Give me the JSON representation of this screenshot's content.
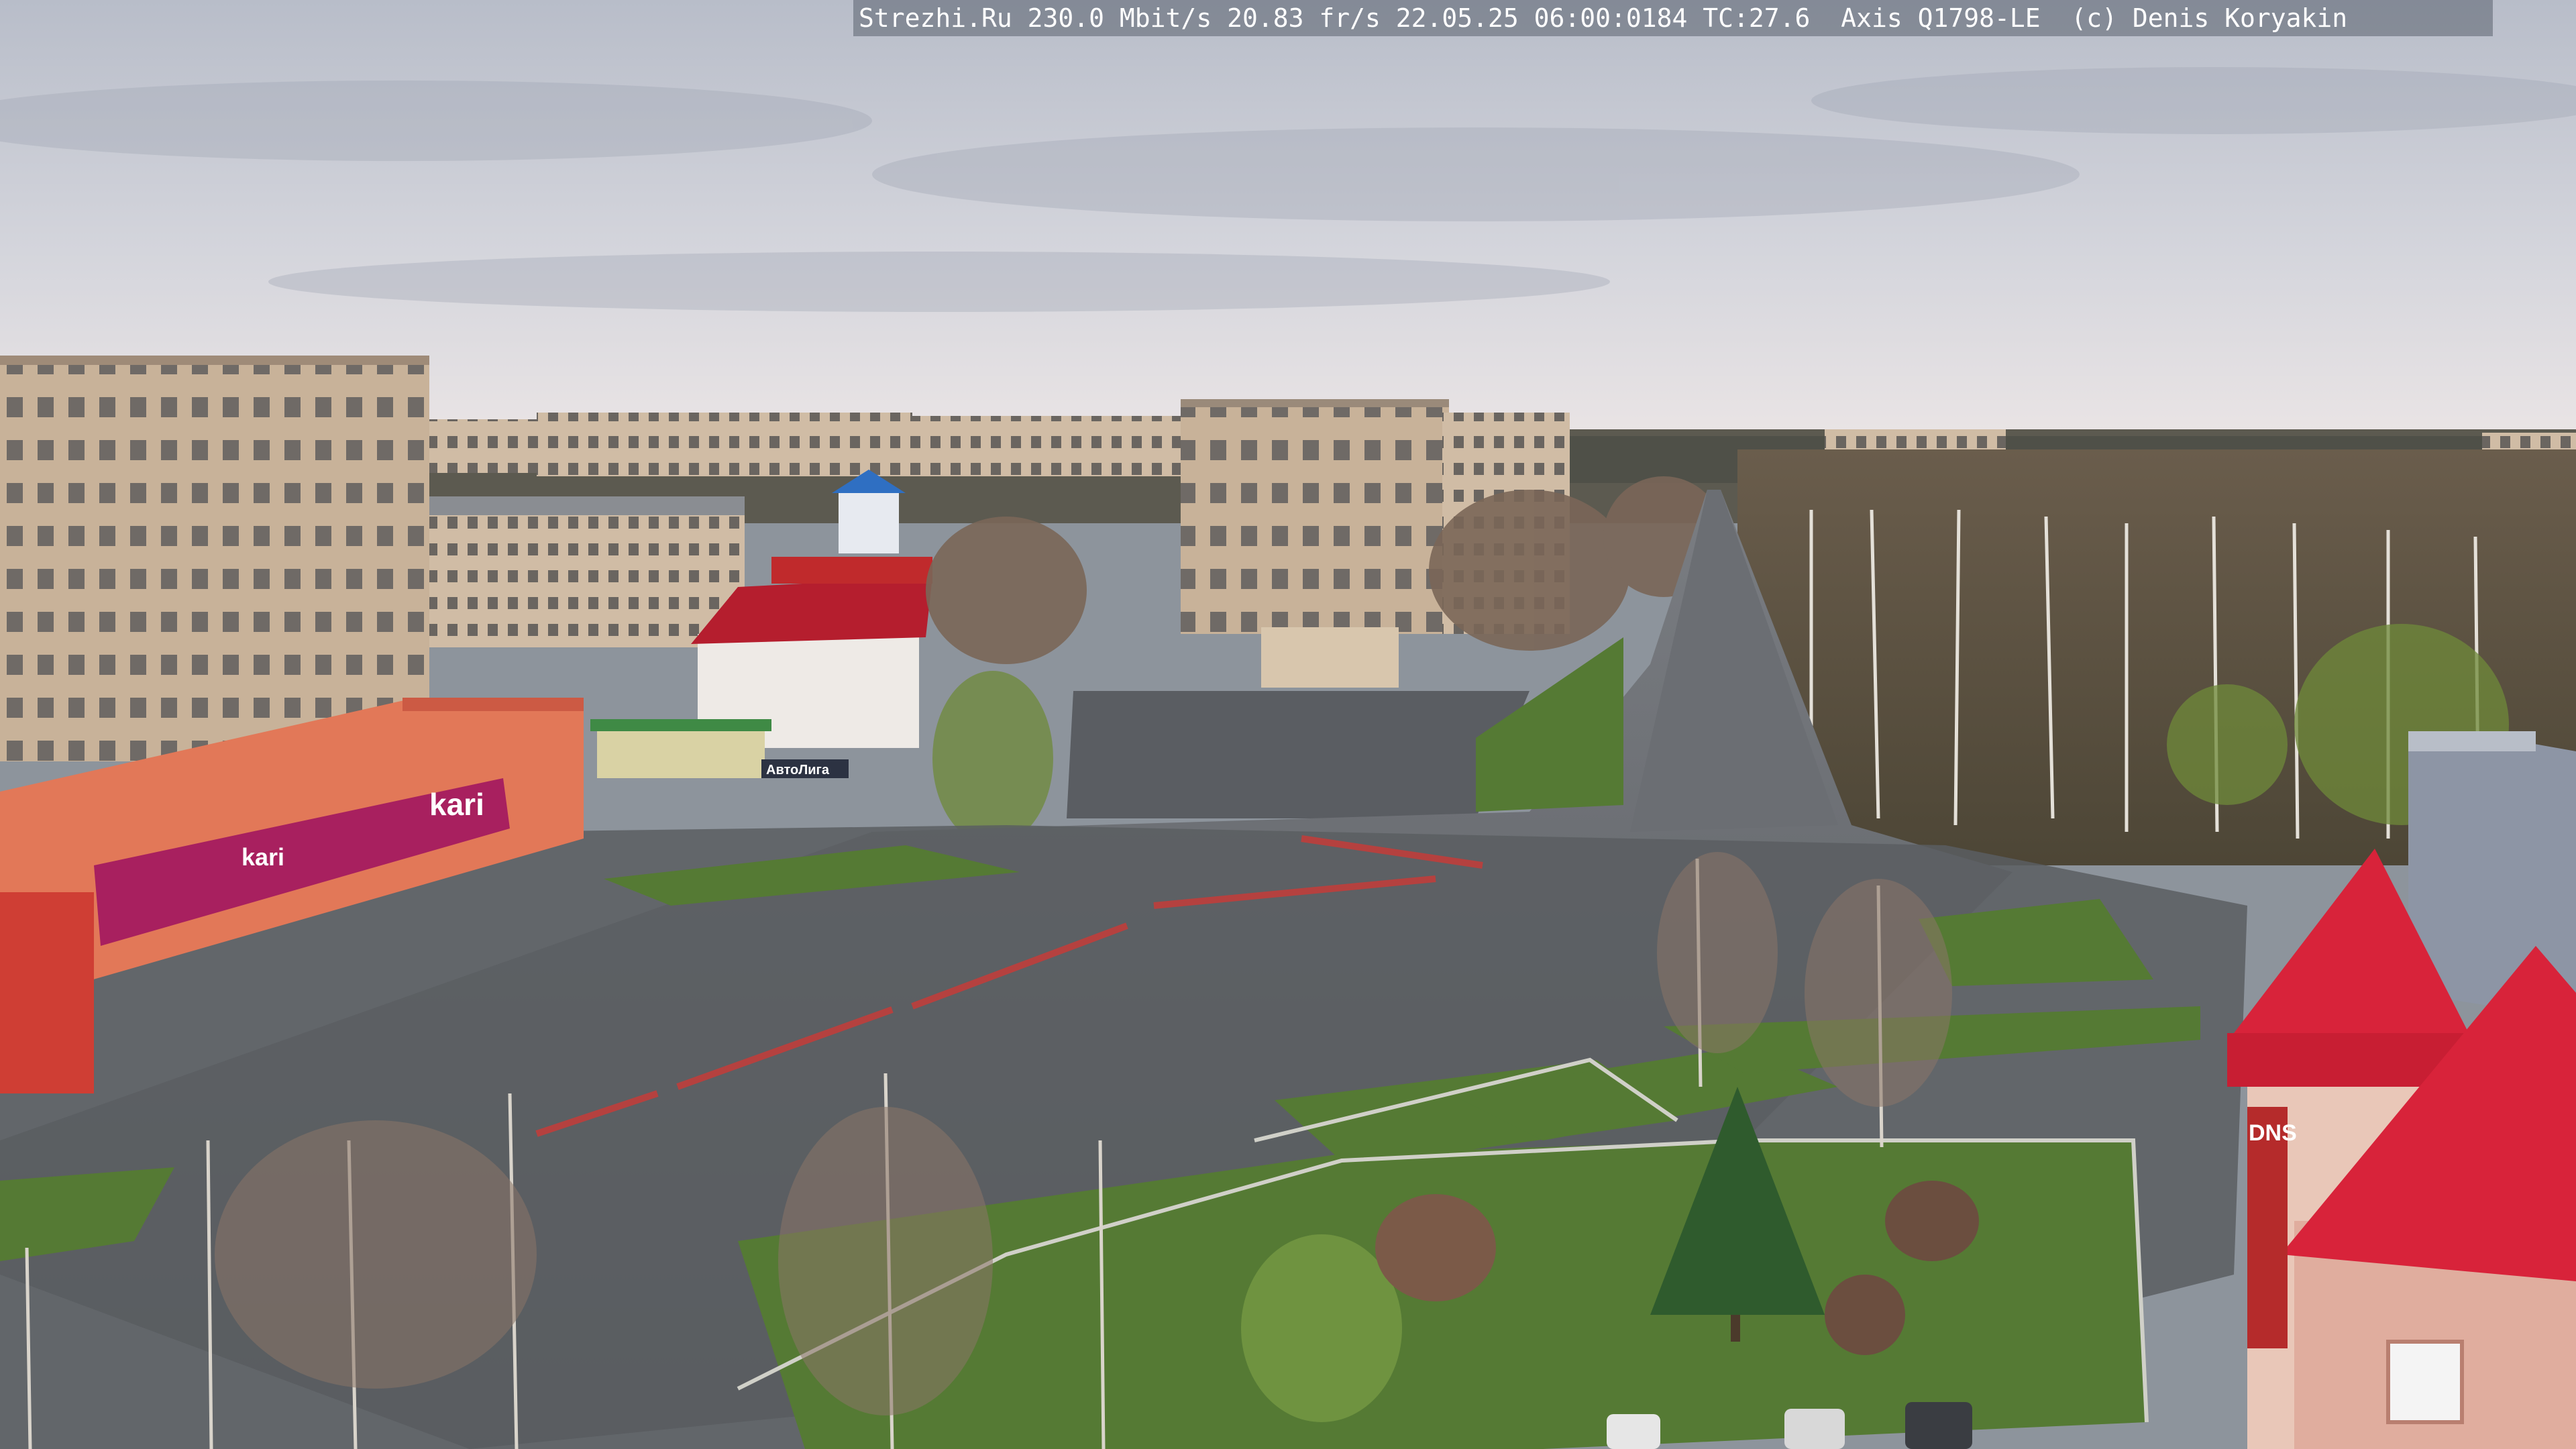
{
  "overlay": {
    "text": "Strezhi.Ru 230.0 Mbit/s 20.83 fr/s 22.05.25 06:00:0184 TC:27.6  Axis Q1798-LE  (c) Denis Koryakin"
  },
  "signs": {
    "store_brand": "kari",
    "store_brand_small": "kari",
    "shop_sign": "АвтоЛига",
    "tower_sign": "DNS"
  },
  "colors": {
    "sky_top": "#c9ccd6",
    "sky_bottom": "#e6e3e6",
    "asphalt": "#5e6166",
    "grass": "#557a34",
    "building_beige": "#cdb59b",
    "store_orange": "#e07656",
    "store_magenta": "#b0216a",
    "roof_red": "#d8233a"
  },
  "icons": {
    "webcam": "photo"
  }
}
